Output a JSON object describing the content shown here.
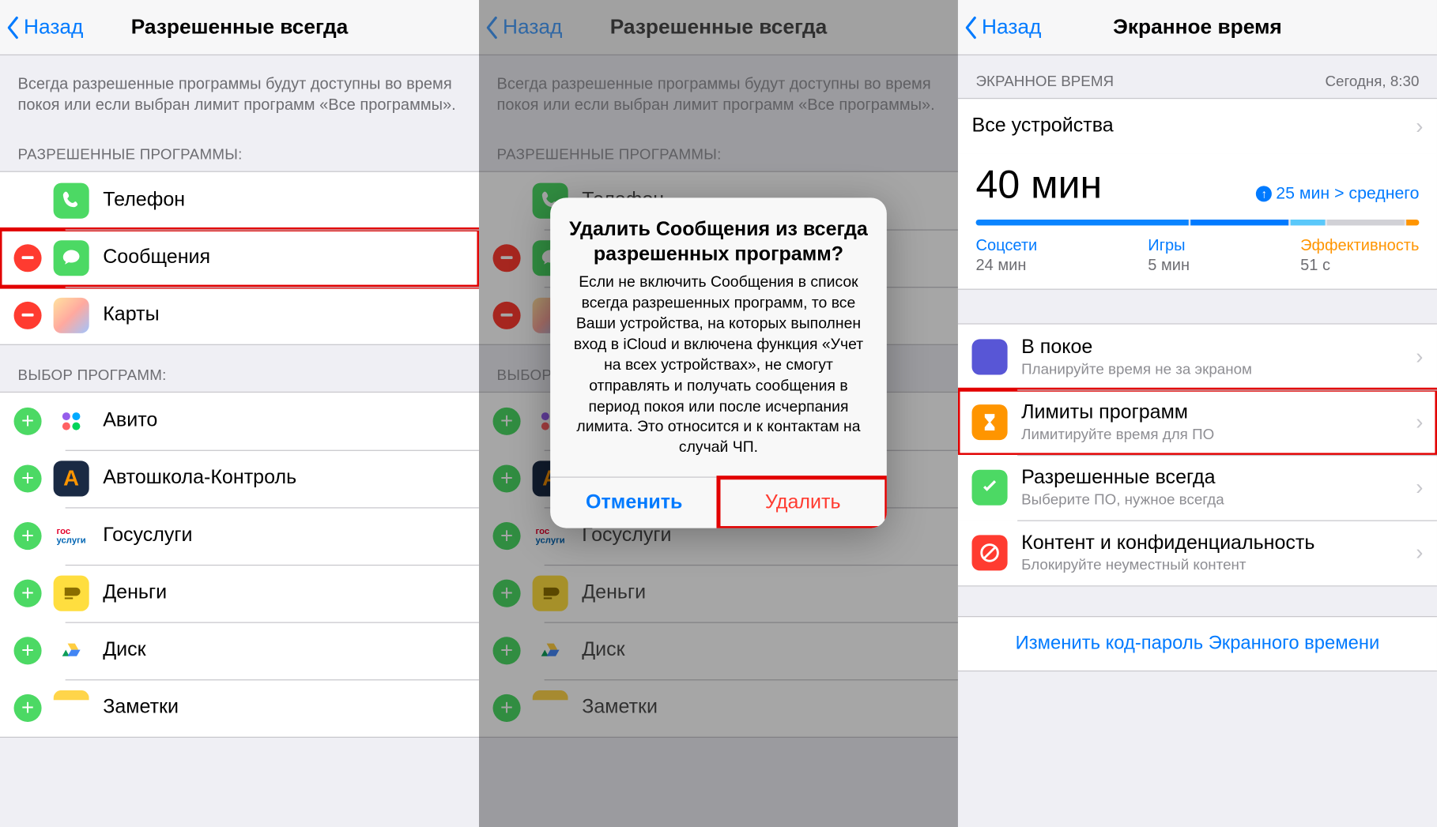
{
  "back_label": "Назад",
  "pane1": {
    "title": "Разрешенные всегда",
    "desc": "Всегда разрешенные программы будут доступны во время покоя или если выбран лимит программ «Все программы».",
    "allowed_header": "РАЗРЕШЕННЫЕ ПРОГРАММЫ:",
    "choose_header": "ВЫБОР ПРОГРАММ:",
    "allowed": [
      {
        "name": "Телефон",
        "icon": "phone",
        "color": "#4cd964",
        "no_btn": true
      },
      {
        "name": "Сообщения",
        "icon": "msg",
        "color": "#4cd964",
        "btn": "minus",
        "hl": true
      },
      {
        "name": "Карты",
        "icon": "maps",
        "color": "#fff",
        "btn": "minus"
      }
    ],
    "choose": [
      {
        "name": "Авито",
        "icon": "avito",
        "color": "#fff"
      },
      {
        "name": "Автошкола-Контроль",
        "icon": "A",
        "color": "#1a2a44"
      },
      {
        "name": "Госуслуги",
        "icon": "gos",
        "color": "#fff"
      },
      {
        "name": "Деньги",
        "icon": "money",
        "color": "#ffde3f"
      },
      {
        "name": "Диск",
        "icon": "drive",
        "color": "#fff"
      },
      {
        "name": "Заметки",
        "icon": "notes",
        "color": "#fff"
      }
    ]
  },
  "pane2": {
    "alert_title": "Удалить Сообщения из всегда разрешенных программ?",
    "alert_body": "Если не включить Сообщения в список всегда разрешенных программ, то все Ваши устройства, на которых выполнен вход в iCloud и включена функция «Учет на всех устройствах», не смогут отправлять и получать сообщения в период покоя или после исчерпания лимита. Это относится и к контактам на случай ЧП.",
    "cancel": "Отменить",
    "delete": "Удалить"
  },
  "pane3": {
    "title": "Экранное время",
    "section_header": "ЭКРАННОЕ ВРЕМЯ",
    "timestamp": "Сегодня, 8:30",
    "devices": "Все устройства",
    "total": "40 мин",
    "trend": "25 мин > среднего",
    "cats": [
      {
        "hdr": "Соцсети",
        "val": "24 мин"
      },
      {
        "hdr": "Игры",
        "val": "5 мин"
      },
      {
        "hdr": "Эффективность",
        "val": "51 с"
      }
    ],
    "settings": [
      {
        "t1": "В покое",
        "t2": "Планируйте время не за экраном",
        "color": "#5856d6",
        "icon": "moon"
      },
      {
        "t1": "Лимиты программ",
        "t2": "Лимитируйте время для ПО",
        "color": "#ff9500",
        "icon": "hourglass",
        "hl": true
      },
      {
        "t1": "Разрешенные всегда",
        "t2": "Выберите ПО, нужное всегда",
        "color": "#4cd964",
        "icon": "check"
      },
      {
        "t1": "Контент и конфиденциальность",
        "t2": "Блокируйте неуместный контент",
        "color": "#ff3b30",
        "icon": "block"
      }
    ],
    "change_code": "Изменить код-пароль Экранного времени"
  }
}
